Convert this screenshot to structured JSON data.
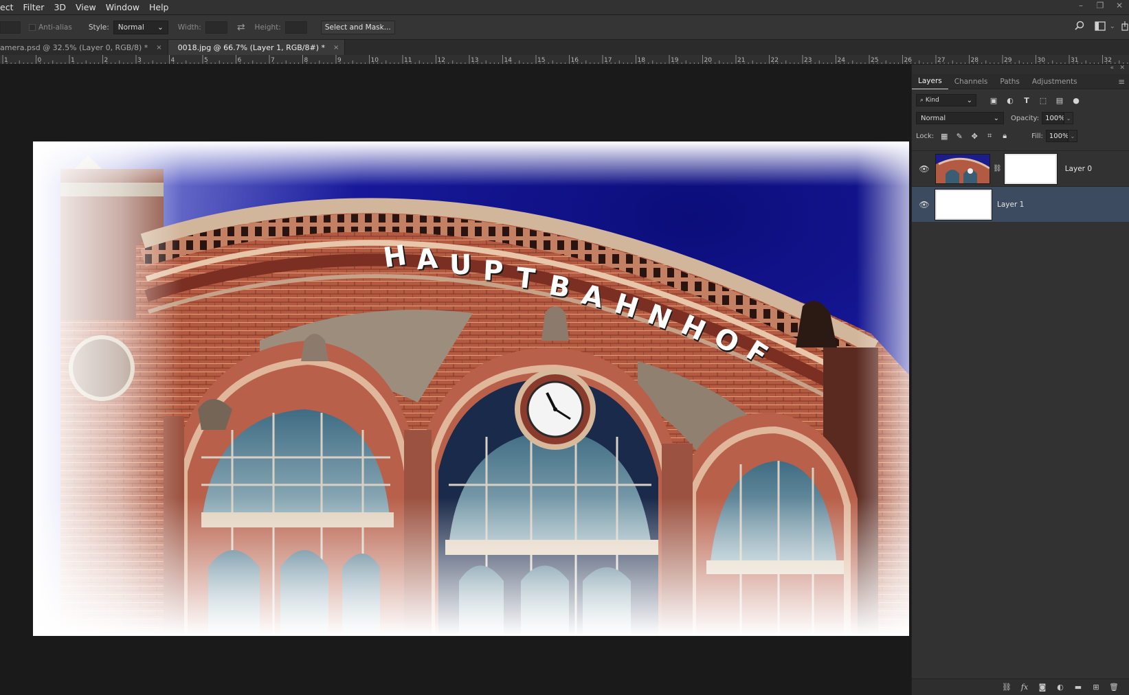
{
  "menu": {
    "items": [
      "ect",
      "Filter",
      "3D",
      "View",
      "Window",
      "Help"
    ]
  },
  "window_controls": {
    "minimize": "–",
    "restore": "❐",
    "close": "✕"
  },
  "options": {
    "antialias_label": "Anti-alias",
    "style_label": "Style:",
    "style_value": "Normal",
    "width_label": "Width:",
    "height_label": "Height:",
    "swap_icon": "⇄",
    "select_mask_label": "Select and Mask..."
  },
  "tabs": [
    {
      "label": "amera.psd @ 32.5% (Layer 0, RGB/8) *",
      "close": "×"
    },
    {
      "label": "0018.jpg @ 66.7% (Layer 1, RGB/8#) *",
      "close": "×"
    }
  ],
  "ruler": {
    "ticks": [
      "1",
      "0",
      "1",
      "2",
      "3",
      "4",
      "5",
      "6",
      "7",
      "8",
      "9",
      "10",
      "11",
      "12",
      "13",
      "14",
      "15",
      "16",
      "17",
      "18",
      "19",
      "20",
      "21",
      "22",
      "23",
      "24",
      "25",
      "26",
      "27",
      "28",
      "29",
      "30",
      "31",
      "32"
    ]
  },
  "image": {
    "sign_text": "HAUPTBAHNHOF",
    "sky_color": "#13178a",
    "brick_color": "#b0533c"
  },
  "panel": {
    "collapse_icon": "«",
    "close_icon": "✕",
    "menu_icon": "≡",
    "tabs": [
      "Layers",
      "Channels",
      "Paths",
      "Adjustments"
    ],
    "kind_label": "Kind",
    "blend_mode": "Normal",
    "opacity_label": "Opacity:",
    "opacity_value": "100%",
    "lock_label": "Lock:",
    "fill_label": "Fill:",
    "fill_value": "100%",
    "dropdown_arrow": "⌄"
  },
  "layers": [
    {
      "name": "Layer 0",
      "has_mask": true,
      "visible": true,
      "selected": false
    },
    {
      "name": "Layer 1",
      "has_mask": false,
      "visible": true,
      "selected": true
    }
  ],
  "colors": {
    "accent_selected": "#3c4b5f",
    "canvas_bg": "#1a1a1a",
    "panel_bg": "#323232"
  }
}
